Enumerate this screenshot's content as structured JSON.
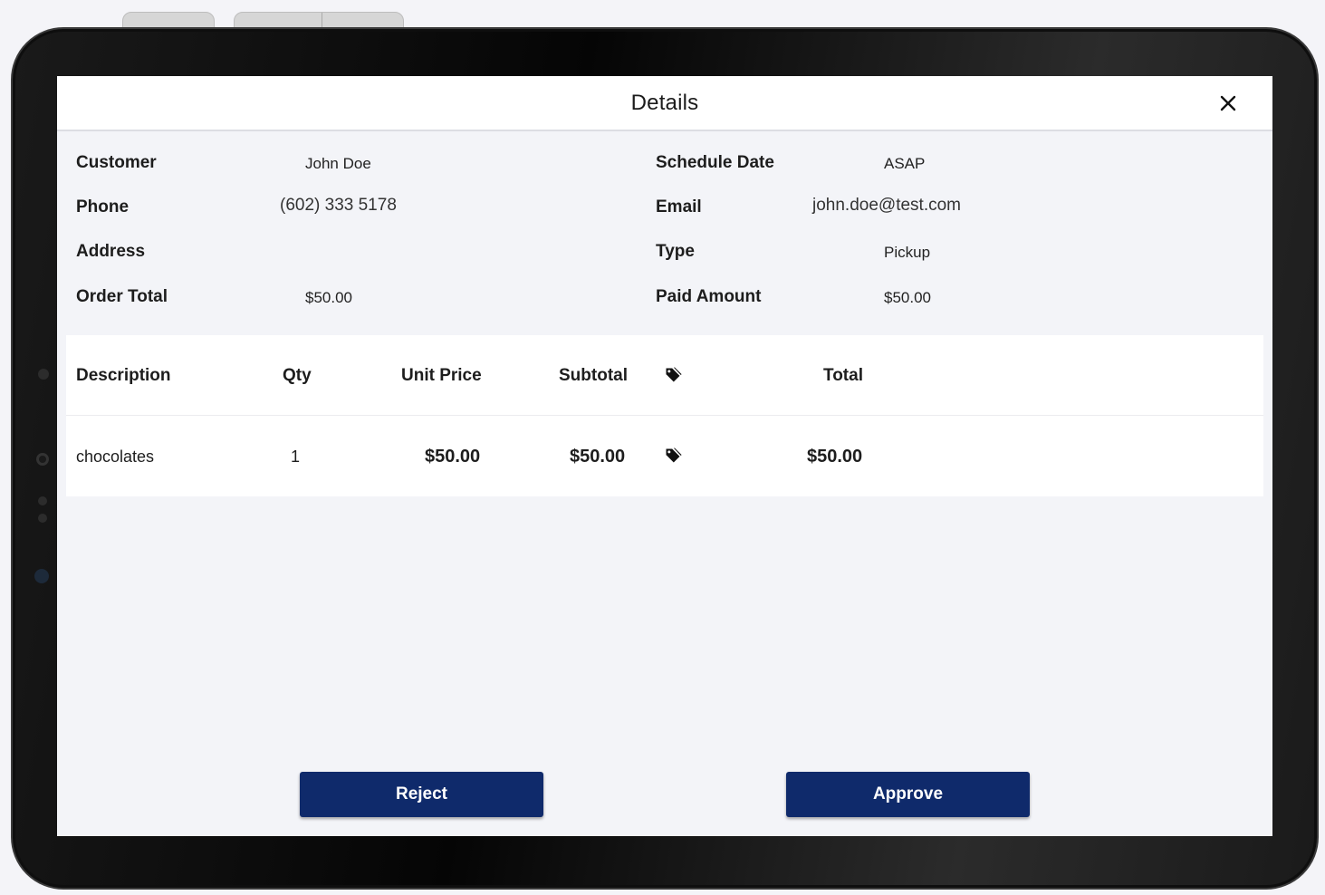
{
  "dialog": {
    "title": "Details",
    "close_icon": "close-icon"
  },
  "info": {
    "customer_label": "Customer",
    "customer_value": "John Doe",
    "phone_label": "Phone",
    "phone_value": "(602) 333 5178",
    "address_label": "Address",
    "address_value": "",
    "order_total_label": "Order Total",
    "order_total_value": "$50.00",
    "schedule_date_label": "Schedule Date",
    "schedule_date_value": "ASAP",
    "email_label": "Email",
    "email_value": "john.doe@test.com",
    "type_label": "Type",
    "type_value": "Pickup",
    "paid_amount_label": "Paid Amount",
    "paid_amount_value": "$50.00"
  },
  "table": {
    "headers": {
      "description": "Description",
      "qty": "Qty",
      "unit_price": "Unit Price",
      "subtotal": "Subtotal",
      "discount_icon": "tag-icon",
      "total": "Total"
    },
    "rows": [
      {
        "description": "chocolates",
        "qty": "1",
        "unit_price": "$50.00",
        "subtotal": "$50.00",
        "discount_icon": "tag-icon",
        "total": "$50.00"
      }
    ]
  },
  "actions": {
    "reject_label": "Reject",
    "approve_label": "Approve"
  },
  "colors": {
    "button_bg": "#0f2a6b",
    "screen_bg": "#f3f4f8",
    "header_bg": "#ffffff"
  }
}
